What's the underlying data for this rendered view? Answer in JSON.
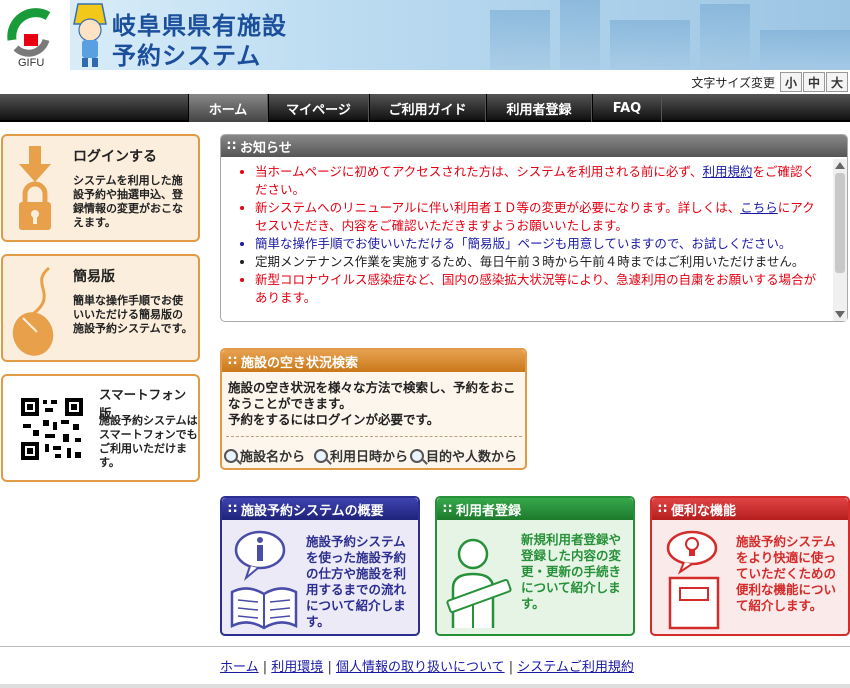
{
  "header": {
    "logo_text": "GIFU",
    "title_line1": "岐阜県県有施設",
    "title_line2": "予約システム"
  },
  "font_size": {
    "label": "文字サイズ変更",
    "small": "小",
    "medium": "中",
    "large": "大"
  },
  "nav": {
    "items": [
      "ホーム",
      "マイページ",
      "ご利用ガイド",
      "利用者登録",
      "FAQ"
    ]
  },
  "left": {
    "login": {
      "title": "ログインする",
      "desc": "システムを利用した施設予約や抽選申込、登録情報の変更がおこなえます。"
    },
    "simple": {
      "title": "簡易版",
      "desc": "簡単な操作手順でお使いいただける簡易版の施設予約システムです。"
    },
    "smartphone": {
      "title": "スマートフォン版",
      "desc": "施設予約システムはスマートフォンでもご利用いただけます。"
    }
  },
  "news": {
    "title": "お知らせ",
    "items": [
      {
        "pre": "当ホームページに初めてアクセスされた方は、システムを利用される前に必ず、",
        "link": "利用規約",
        "post": "をご確認ください。"
      },
      {
        "pre": "新システムへのリニューアルに伴い利用者ＩＤ等の変更が必要になります。詳しくは、",
        "link": "こちら",
        "post": "にアクセスいただき、内容をご確認いただきますようお願いいたします。"
      },
      {
        "text": "簡単な操作手順でお使いいただける「簡易版」ページも用意していますので、お試しください。"
      },
      {
        "text": "定期メンテナンス作業を実施するため、毎日午前３時から午前４時まではご利用いただけません。"
      },
      {
        "text": "新型コロナウイルス感染症など、国内の感染拡大状況等により、急遽利用の自粛をお願いする場合があります。"
      }
    ]
  },
  "vacancy": {
    "title": "施設の空き状況検索",
    "desc1": "施設の空き状況を様々な方法で検索し、予約をおこなうことができます。",
    "desc2": "予約をするにはログインが必要です。",
    "btn_name": "施設名から",
    "btn_date": "利用日時から",
    "btn_purpose": "目的や人数から"
  },
  "cards": {
    "overview": {
      "title": "施設予約システムの概要",
      "desc": "施設予約システムを使った施設予約の仕方や施設を利用するまでの流れについて紹介します。"
    },
    "register": {
      "title": "利用者登録",
      "desc": "新規利用者登録や登録した内容の変更・更新の手続きについて紹介します。"
    },
    "features": {
      "title": "便利な機能",
      "desc": "施設予約システムをより快適に使っていただくための便利な機能について紹介します。"
    }
  },
  "footer": {
    "links": [
      "ホーム",
      "利用環境",
      "個人情報の取り扱いについて",
      "システムご利用規約"
    ],
    "sep": "|"
  },
  "colors": {
    "accent_orange": "#e19a45",
    "nav_black": "#111111",
    "notice_red": "#e60012",
    "link_blue": "#1a1aa6",
    "card_blue": "#2c2f8f",
    "card_green": "#27913a",
    "card_red": "#d42b2b"
  }
}
